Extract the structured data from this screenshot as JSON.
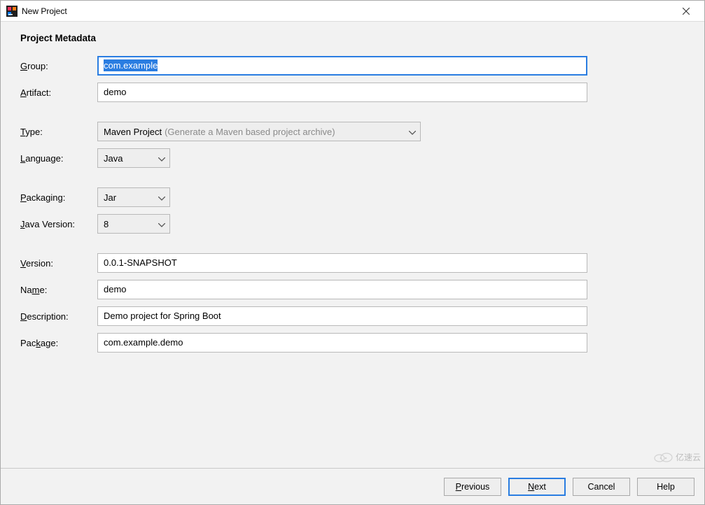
{
  "window": {
    "title": "New Project"
  },
  "section": {
    "heading": "Project Metadata"
  },
  "labels": {
    "group": "roup:",
    "artifact": "rtifact:",
    "type": "ype:",
    "language": "anguage:",
    "packaging": "ackaging:",
    "java_version": "ava Version:",
    "version": "ersion:",
    "name": "e:",
    "description": "escription:",
    "package": "age:"
  },
  "mnemonics": {
    "group": "G",
    "artifact": "A",
    "type": "T",
    "language": "L",
    "packaging_pre": "P",
    "java_pre": "J",
    "version": "V",
    "name_pre": "Na",
    "name_mn": "m",
    "description": "D",
    "package_pre": "Pac",
    "package_mn": "k"
  },
  "fields": {
    "group": "com.example",
    "artifact": "demo",
    "type_value": "Maven Project",
    "type_hint": "(Generate a Maven based project archive)",
    "language": "Java",
    "packaging": "Jar",
    "java_version": "8",
    "version": "0.0.1-SNAPSHOT",
    "name": "demo",
    "description": "Demo project for Spring Boot",
    "package": "com.example.demo"
  },
  "buttons": {
    "previous": "revious",
    "previous_mn": "P",
    "next": "ext",
    "next_mn": "N",
    "cancel": "Cancel",
    "help": "Help"
  },
  "watermark": "亿速云"
}
